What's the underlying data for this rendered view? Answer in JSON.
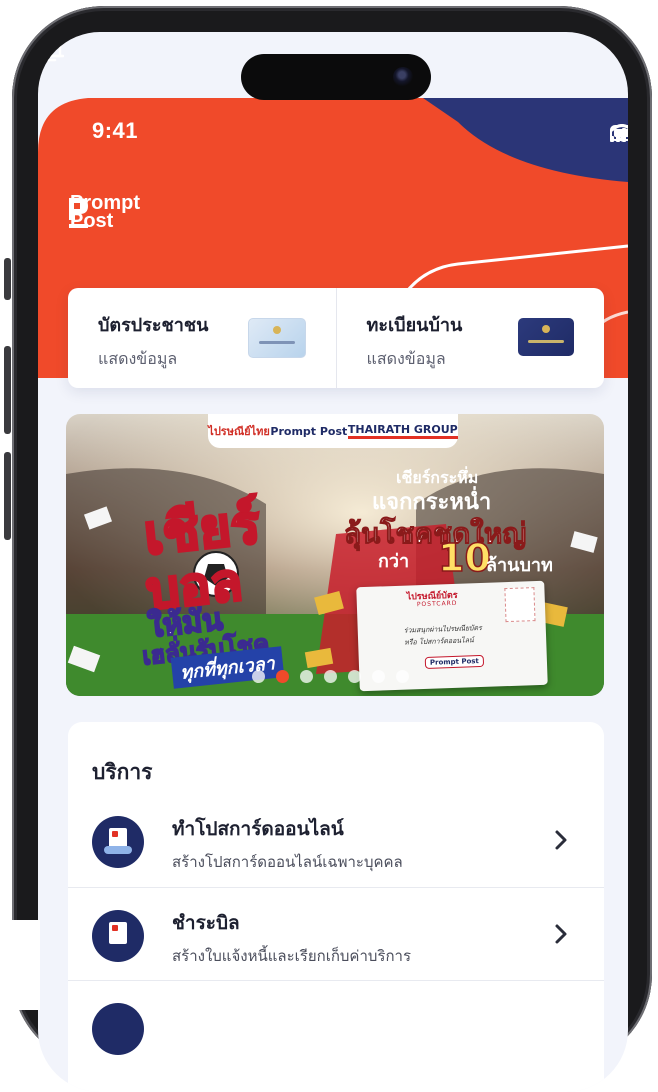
{
  "status": {
    "time": "9:41"
  },
  "brand": {
    "line1": "Prompt",
    "line2": "Post"
  },
  "colors": {
    "brand_red": "#f04a2a",
    "navy": "#1f2b66",
    "bg": "#f2f4fb"
  },
  "id_cards": [
    {
      "title": "บัตรประชาชน",
      "subtitle": "แสดงข้อมูล"
    },
    {
      "title": "ทะเบียนบ้าน",
      "subtitle": "แสดงข้อมูล"
    }
  ],
  "banner": {
    "logos": [
      "ไปรษณีย์ไทย",
      "Prompt Post",
      "THAIRATH GROUP"
    ],
    "hero_line1": "เชียร์",
    "hero_line2": "บอล",
    "tag1": "ให้มัน",
    "tag2": "เฮลั่นรับโชค",
    "tag3": "ทุกที่ทุกเวลา",
    "right_line1": "เชียร์กระหึ่ม",
    "right_line2": "แจกกระหน่ำ",
    "right_line3": "ลุ้นโชคชุดใหญ่",
    "right_line4": "กว่า",
    "right_big": "10",
    "right_line5": "ล้านบาท",
    "postcard_title": "ไปรษณีย์บัตร",
    "postcard_sub": "POSTCARD",
    "postcard_line1": "ร่วมสนุกผ่านไปรษณียบัตร",
    "postcard_line2": "หรือ โปสการ์ดออนไลน์",
    "postcard_btn": "Prompt Post",
    "slide_count": 7,
    "active_slide": 1
  },
  "services": {
    "heading": "บริการ",
    "items": [
      {
        "title": "ทำโปสการ์ดออนไลน์",
        "subtitle": "สร้างโปสการ์ดออนไลน์เฉพาะบุคคล",
        "icon": "postcard-icon"
      },
      {
        "title": "ชำระบิล",
        "subtitle": "สร้างใบแจ้งหนี้และเรียกเก็บค่าบริการ",
        "icon": "bill-icon"
      }
    ]
  }
}
